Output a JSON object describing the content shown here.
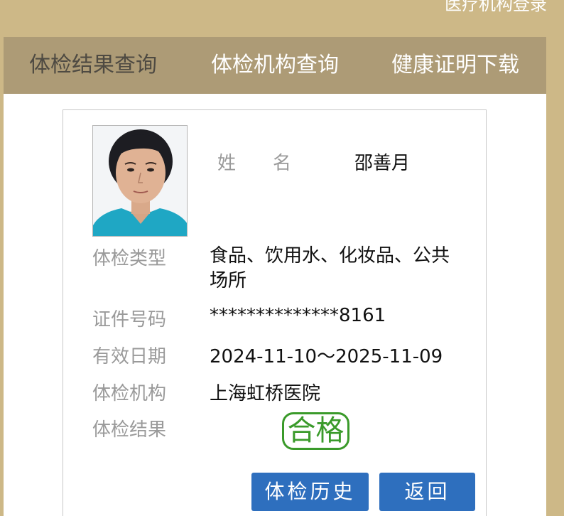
{
  "header": {
    "top_link": "医疗机构登录"
  },
  "nav": {
    "tabs": [
      {
        "label": "体检结果查询",
        "active": true
      },
      {
        "label": "体检机构查询",
        "active": false
      },
      {
        "label": "健康证明下载",
        "active": false
      }
    ]
  },
  "record": {
    "name_label": "姓名",
    "name_value": "邵善月",
    "exam_type_label": "体检类型",
    "exam_type_value": "食品、饮用水、化妆品、公共场所",
    "id_label": "证件号码",
    "id_value": "**************8161",
    "valid_label": "有效日期",
    "valid_value": "2024-11-10～2025-11-09",
    "institution_label": "体检机构",
    "institution_value": "上海虹桥医院",
    "result_label": "体检结果",
    "result_value": "合格"
  },
  "buttons": {
    "history": "体检历史",
    "back": "返回"
  },
  "colors": {
    "background": "#cdb887",
    "nav": "#ad9b76",
    "button": "#2e6fbe",
    "stamp": "#3a9a2a"
  }
}
